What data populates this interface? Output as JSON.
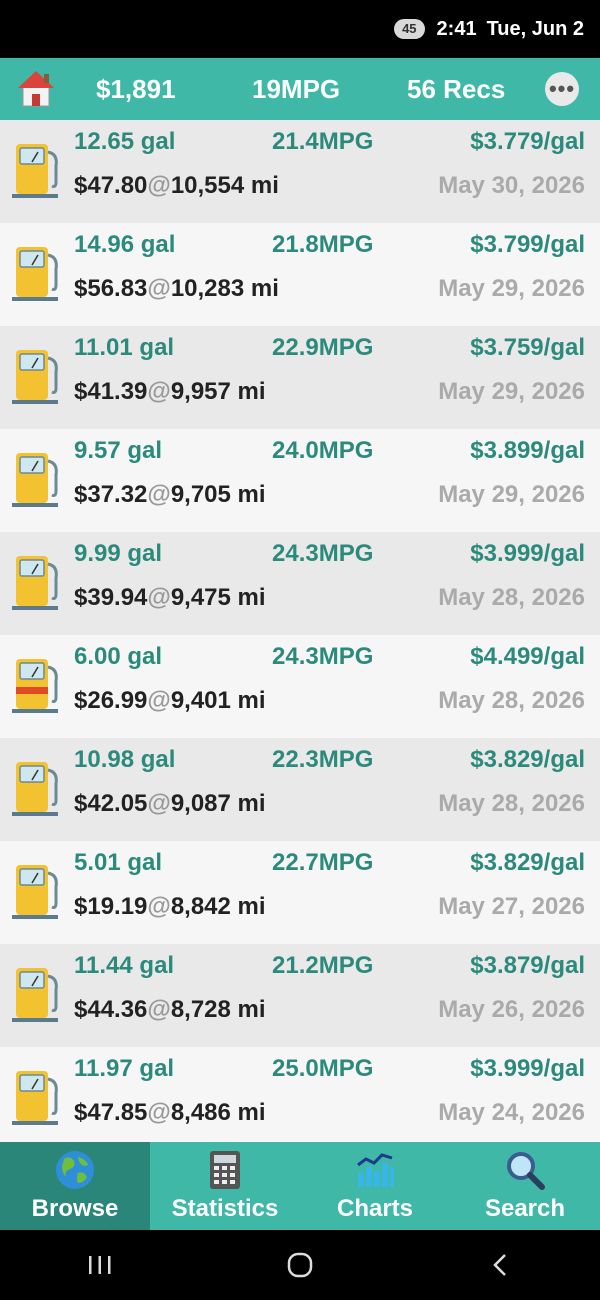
{
  "status_bar": {
    "battery": "45",
    "time": "2:41",
    "date": "Tue, Jun 2"
  },
  "header": {
    "total_cost": "$1,891",
    "avg_mpg": "19MPG",
    "record_count": "56 Recs"
  },
  "records": [
    {
      "gallons": "12.65 gal",
      "mpg": "21.4MPG",
      "price": "$3.779/gal",
      "cost": "$47.80",
      "odometer": "10,554 mi",
      "date": "May 30, 2026",
      "partial": false
    },
    {
      "gallons": "14.96 gal",
      "mpg": "21.8MPG",
      "price": "$3.799/gal",
      "cost": "$56.83",
      "odometer": "10,283 mi",
      "date": "May 29, 2026",
      "partial": false
    },
    {
      "gallons": "11.01 gal",
      "mpg": "22.9MPG",
      "price": "$3.759/gal",
      "cost": "$41.39",
      "odometer": "9,957 mi",
      "date": "May 29, 2026",
      "partial": false
    },
    {
      "gallons": "9.57 gal",
      "mpg": "24.0MPG",
      "price": "$3.899/gal",
      "cost": "$37.32",
      "odometer": "9,705 mi",
      "date": "May 29, 2026",
      "partial": false
    },
    {
      "gallons": "9.99 gal",
      "mpg": "24.3MPG",
      "price": "$3.999/gal",
      "cost": "$39.94",
      "odometer": "9,475 mi",
      "date": "May 28, 2026",
      "partial": false
    },
    {
      "gallons": "6.00 gal",
      "mpg": "24.3MPG",
      "price": "$4.499/gal",
      "cost": "$26.99",
      "odometer": "9,401 mi",
      "date": "May 28, 2026",
      "partial": true
    },
    {
      "gallons": "10.98 gal",
      "mpg": "22.3MPG",
      "price": "$3.829/gal",
      "cost": "$42.05",
      "odometer": "9,087 mi",
      "date": "May 28, 2026",
      "partial": false
    },
    {
      "gallons": "5.01 gal",
      "mpg": "22.7MPG",
      "price": "$3.829/gal",
      "cost": "$19.19",
      "odometer": "8,842 mi",
      "date": "May 27, 2026",
      "partial": false
    },
    {
      "gallons": "11.44 gal",
      "mpg": "21.2MPG",
      "price": "$3.879/gal",
      "cost": "$44.36",
      "odometer": "8,728 mi",
      "date": "May 26, 2026",
      "partial": false
    },
    {
      "gallons": "11.97 gal",
      "mpg": "25.0MPG",
      "price": "$3.999/gal",
      "cost": "$47.85",
      "odometer": "8,486 mi",
      "date": "May 24, 2026",
      "partial": false
    }
  ],
  "at_symbol": "@",
  "bottom_nav": [
    {
      "label": "Browse",
      "icon": "globe-icon",
      "active": true
    },
    {
      "label": "Statistics",
      "icon": "calculator-icon",
      "active": false
    },
    {
      "label": "Charts",
      "icon": "bar-chart-icon",
      "active": false
    },
    {
      "label": "Search",
      "icon": "magnifier-icon",
      "active": false
    }
  ],
  "colors": {
    "accent": "#3fb8a7",
    "accent_dark": "#2a8679",
    "value_green": "#2c8a7d",
    "row_odd": "#e9e9e9",
    "row_even": "#f6f6f6"
  }
}
